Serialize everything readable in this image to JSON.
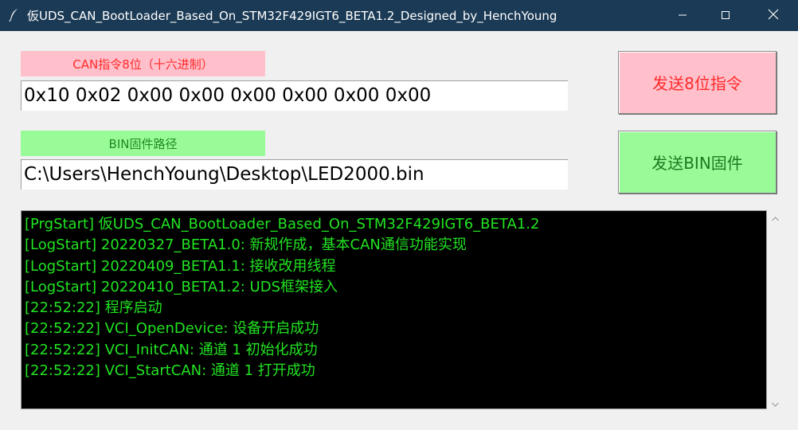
{
  "window": {
    "title": "仮UDS_CAN_BootLoader_Based_On_STM32F429IGT6_BETA1.2_Designed_by_HenchYoung",
    "icons": [
      "feather-icon",
      "minimize-icon",
      "maximize-icon",
      "close-icon"
    ]
  },
  "can_command": {
    "label": "CAN指令8位（十六进制）",
    "value": "0x10 0x02 0x00 0x00 0x00 0x00 0x00 0x00",
    "send_button": "发送8位指令",
    "accent_bg": "#ffc0cb",
    "accent_text": "#ff2a2a"
  },
  "bin_firmware": {
    "label": "BIN固件路径",
    "value": "C:\\Users\\HenchYoung\\Desktop\\LED2000.bin",
    "send_button": "发送BIN固件",
    "accent_bg": "#98fb98",
    "accent_text": "#1f8a1f"
  },
  "log": {
    "text_color": "#22e322",
    "background": "#000000",
    "lines": [
      "[PrgStart] 仮UDS_CAN_BootLoader_Based_On_STM32F429IGT6_BETA1.2",
      "[LogStart] 20220327_BETA1.0:  新规作成，基本CAN通信功能实现",
      "[LogStart] 20220409_BETA1.1:  接收改用线程",
      "[LogStart] 20220410_BETA1.2:  UDS框架接入",
      "[22:52:22] 程序启动",
      "[22:52:22] VCI_OpenDevice: 设备开启成功",
      "[22:52:22] VCI_InitCAN: 通道 1 初始化成功",
      "[22:52:22] VCI_StartCAN: 通道 1 打开成功"
    ]
  },
  "colors": {
    "titlebar": "#1b3a55",
    "window_bg": "#f0f0f0"
  }
}
